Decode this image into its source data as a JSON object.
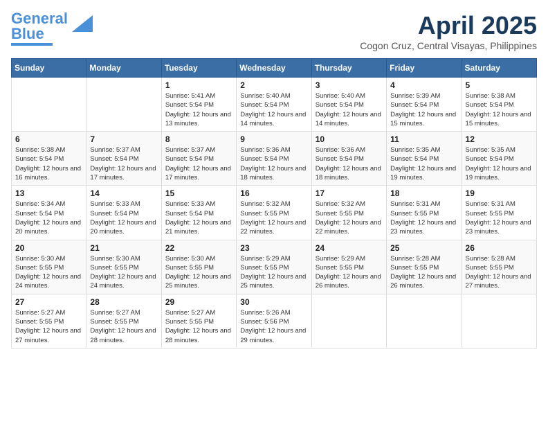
{
  "header": {
    "logo_line1": "General",
    "logo_line2": "Blue",
    "month_title": "April 2025",
    "location": "Cogon Cruz, Central Visayas, Philippines"
  },
  "weekdays": [
    "Sunday",
    "Monday",
    "Tuesday",
    "Wednesday",
    "Thursday",
    "Friday",
    "Saturday"
  ],
  "weeks": [
    [
      {
        "day": "",
        "info": ""
      },
      {
        "day": "",
        "info": ""
      },
      {
        "day": "1",
        "info": "Sunrise: 5:41 AM\nSunset: 5:54 PM\nDaylight: 12 hours and 13 minutes."
      },
      {
        "day": "2",
        "info": "Sunrise: 5:40 AM\nSunset: 5:54 PM\nDaylight: 12 hours and 14 minutes."
      },
      {
        "day": "3",
        "info": "Sunrise: 5:40 AM\nSunset: 5:54 PM\nDaylight: 12 hours and 14 minutes."
      },
      {
        "day": "4",
        "info": "Sunrise: 5:39 AM\nSunset: 5:54 PM\nDaylight: 12 hours and 15 minutes."
      },
      {
        "day": "5",
        "info": "Sunrise: 5:38 AM\nSunset: 5:54 PM\nDaylight: 12 hours and 15 minutes."
      }
    ],
    [
      {
        "day": "6",
        "info": "Sunrise: 5:38 AM\nSunset: 5:54 PM\nDaylight: 12 hours and 16 minutes."
      },
      {
        "day": "7",
        "info": "Sunrise: 5:37 AM\nSunset: 5:54 PM\nDaylight: 12 hours and 17 minutes."
      },
      {
        "day": "8",
        "info": "Sunrise: 5:37 AM\nSunset: 5:54 PM\nDaylight: 12 hours and 17 minutes."
      },
      {
        "day": "9",
        "info": "Sunrise: 5:36 AM\nSunset: 5:54 PM\nDaylight: 12 hours and 18 minutes."
      },
      {
        "day": "10",
        "info": "Sunrise: 5:36 AM\nSunset: 5:54 PM\nDaylight: 12 hours and 18 minutes."
      },
      {
        "day": "11",
        "info": "Sunrise: 5:35 AM\nSunset: 5:54 PM\nDaylight: 12 hours and 19 minutes."
      },
      {
        "day": "12",
        "info": "Sunrise: 5:35 AM\nSunset: 5:54 PM\nDaylight: 12 hours and 19 minutes."
      }
    ],
    [
      {
        "day": "13",
        "info": "Sunrise: 5:34 AM\nSunset: 5:54 PM\nDaylight: 12 hours and 20 minutes."
      },
      {
        "day": "14",
        "info": "Sunrise: 5:33 AM\nSunset: 5:54 PM\nDaylight: 12 hours and 20 minutes."
      },
      {
        "day": "15",
        "info": "Sunrise: 5:33 AM\nSunset: 5:54 PM\nDaylight: 12 hours and 21 minutes."
      },
      {
        "day": "16",
        "info": "Sunrise: 5:32 AM\nSunset: 5:55 PM\nDaylight: 12 hours and 22 minutes."
      },
      {
        "day": "17",
        "info": "Sunrise: 5:32 AM\nSunset: 5:55 PM\nDaylight: 12 hours and 22 minutes."
      },
      {
        "day": "18",
        "info": "Sunrise: 5:31 AM\nSunset: 5:55 PM\nDaylight: 12 hours and 23 minutes."
      },
      {
        "day": "19",
        "info": "Sunrise: 5:31 AM\nSunset: 5:55 PM\nDaylight: 12 hours and 23 minutes."
      }
    ],
    [
      {
        "day": "20",
        "info": "Sunrise: 5:30 AM\nSunset: 5:55 PM\nDaylight: 12 hours and 24 minutes."
      },
      {
        "day": "21",
        "info": "Sunrise: 5:30 AM\nSunset: 5:55 PM\nDaylight: 12 hours and 24 minutes."
      },
      {
        "day": "22",
        "info": "Sunrise: 5:30 AM\nSunset: 5:55 PM\nDaylight: 12 hours and 25 minutes."
      },
      {
        "day": "23",
        "info": "Sunrise: 5:29 AM\nSunset: 5:55 PM\nDaylight: 12 hours and 25 minutes."
      },
      {
        "day": "24",
        "info": "Sunrise: 5:29 AM\nSunset: 5:55 PM\nDaylight: 12 hours and 26 minutes."
      },
      {
        "day": "25",
        "info": "Sunrise: 5:28 AM\nSunset: 5:55 PM\nDaylight: 12 hours and 26 minutes."
      },
      {
        "day": "26",
        "info": "Sunrise: 5:28 AM\nSunset: 5:55 PM\nDaylight: 12 hours and 27 minutes."
      }
    ],
    [
      {
        "day": "27",
        "info": "Sunrise: 5:27 AM\nSunset: 5:55 PM\nDaylight: 12 hours and 27 minutes."
      },
      {
        "day": "28",
        "info": "Sunrise: 5:27 AM\nSunset: 5:55 PM\nDaylight: 12 hours and 28 minutes."
      },
      {
        "day": "29",
        "info": "Sunrise: 5:27 AM\nSunset: 5:55 PM\nDaylight: 12 hours and 28 minutes."
      },
      {
        "day": "30",
        "info": "Sunrise: 5:26 AM\nSunset: 5:56 PM\nDaylight: 12 hours and 29 minutes."
      },
      {
        "day": "",
        "info": ""
      },
      {
        "day": "",
        "info": ""
      },
      {
        "day": "",
        "info": ""
      }
    ]
  ]
}
